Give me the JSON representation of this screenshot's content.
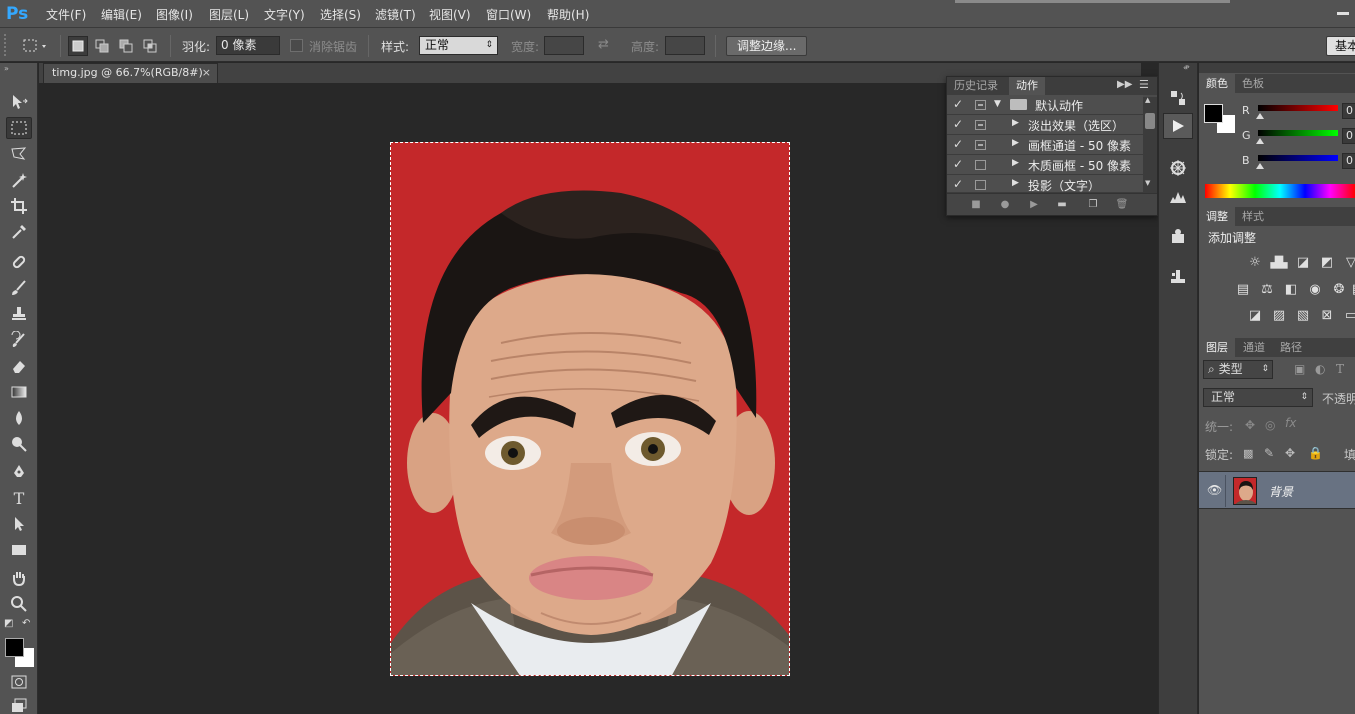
{
  "app": {
    "logo": "Ps",
    "accent": "#34a8ff"
  },
  "menu": [
    "文件(F)",
    "编辑(E)",
    "图像(I)",
    "图层(L)",
    "文字(Y)",
    "选择(S)",
    "滤镜(T)",
    "视图(V)",
    "窗口(W)",
    "帮助(H)"
  ],
  "options": {
    "feather_label": "羽化:",
    "feather_value": "0 像素",
    "antialias_label": "消除锯齿",
    "style_label": "样式:",
    "style_value": "正常",
    "width_label": "宽度:",
    "height_label": "高度:",
    "refine_edge_button": "调整边缘...",
    "workspace_button": "基本"
  },
  "document": {
    "tab_title": "timg.jpg @ 66.7%(RGB/8#)",
    "close": "×",
    "image_background": "#c4282a"
  },
  "actions_panel": {
    "tabs": [
      "历史记录",
      "动作"
    ],
    "active_tab": "动作",
    "rows": [
      {
        "label": "默认动作",
        "checked": true,
        "box": true,
        "is_set": true
      },
      {
        "label": "淡出效果（选区）",
        "checked": true,
        "box": true,
        "is_set": false
      },
      {
        "label": "画框通道 - 50 像素",
        "checked": true,
        "box": true,
        "is_set": false
      },
      {
        "label": "木质画框 - 50 像素",
        "checked": true,
        "box": false,
        "is_set": false
      },
      {
        "label": "投影（文字）",
        "checked": true,
        "box": false,
        "is_set": false
      }
    ]
  },
  "color_panel": {
    "tabs": [
      "颜色",
      "色板"
    ],
    "channels": [
      {
        "label": "R",
        "value": "0",
        "color": "#d11b1b"
      },
      {
        "label": "G",
        "value": "0",
        "color": "#1bb31b"
      },
      {
        "label": "B",
        "value": "0",
        "color": "#1b1bd1"
      }
    ],
    "foreground": "#000000",
    "background": "#ffffff"
  },
  "adjustments_panel": {
    "tabs": [
      "调整",
      "样式"
    ],
    "title": "添加调整"
  },
  "layers_panel": {
    "tabs": [
      "图层",
      "通道",
      "路径"
    ],
    "filter_kind": "类型",
    "blend_mode": "正常",
    "opacity_label": "不透明",
    "unify_label": "统一:",
    "lock_label": "锁定:",
    "fill_label": "填",
    "layers": [
      {
        "name": "背景",
        "visible": true
      }
    ]
  }
}
